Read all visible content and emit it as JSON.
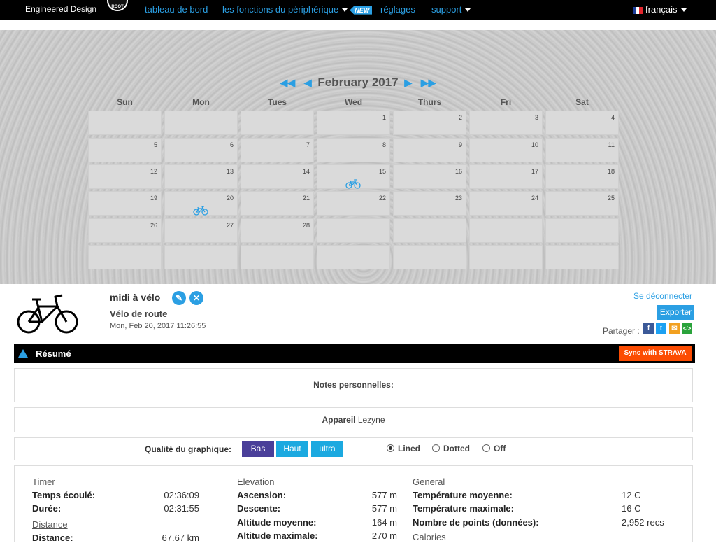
{
  "nav": {
    "brand": "Engineered Design",
    "logo_text": "ROOT",
    "dashboard": "tableau de bord",
    "device_functions": "les fonctions du périphérique",
    "new_badge": "NEW",
    "settings": "réglages",
    "support": "support",
    "language": "français"
  },
  "calendar": {
    "month": "February 2017",
    "days_of_week": [
      "Sun",
      "Mon",
      "Tues",
      "Wed",
      "Thurs",
      "Fri",
      "Sat"
    ],
    "dates": [
      "1",
      "2",
      "3",
      "4",
      "5",
      "6",
      "7",
      "8",
      "9",
      "10",
      "11",
      "12",
      "13",
      "14",
      "15",
      "16",
      "17",
      "18",
      "19",
      "20",
      "21",
      "22",
      "23",
      "24",
      "25",
      "26",
      "27",
      "28"
    ],
    "activity_days": [
      15,
      20
    ]
  },
  "activity": {
    "title": "midi à vélo",
    "type": "Vélo de route",
    "date": "Mon, Feb 20, 2017 11:26:55",
    "logout": "Se déconnecter",
    "export": "Exporter",
    "share_label": "Partager :"
  },
  "summary": {
    "label": "Résumé",
    "strava_btn": "Sync with STRAVA",
    "notes_label": "Notes personnelles:",
    "device_label": "Appareil",
    "device_value": "Lezyne",
    "graph_quality_label": "Qualité du graphique:",
    "quality_options": [
      "Bas",
      "Haut",
      "ultra"
    ],
    "line_options": [
      "Lined",
      "Dotted",
      "Off"
    ],
    "line_selected": "Lined"
  },
  "stats": {
    "timer": {
      "title": "Timer",
      "rows": [
        {
          "k": "Temps écoulé:",
          "v": "02:36:09"
        },
        {
          "k": "Durée:",
          "v": "02:31:55"
        }
      ]
    },
    "distance": {
      "title": "Distance",
      "rows": [
        {
          "k": "Distance:",
          "v": "67.67 km"
        }
      ]
    },
    "elevation": {
      "title": "Elevation",
      "rows": [
        {
          "k": "Ascension:",
          "v": "577 m"
        },
        {
          "k": "Descente:",
          "v": "577 m"
        },
        {
          "k": "Altitude moyenne:",
          "v": "164 m"
        },
        {
          "k": "Altitude maximale:",
          "v": "270 m"
        }
      ]
    },
    "general": {
      "title": "General",
      "rows": [
        {
          "k": "Température moyenne:",
          "v": "12 C"
        },
        {
          "k": "Température maximale:",
          "v": "16 C"
        },
        {
          "k": "Nombre de points (données):",
          "v": "2,952 recs"
        },
        {
          "k": "Calories",
          "v": ""
        }
      ]
    }
  },
  "colors": {
    "accent": "#2b9fe3",
    "strava": "#fc4c02",
    "quality_selected": "#4a3f99"
  }
}
